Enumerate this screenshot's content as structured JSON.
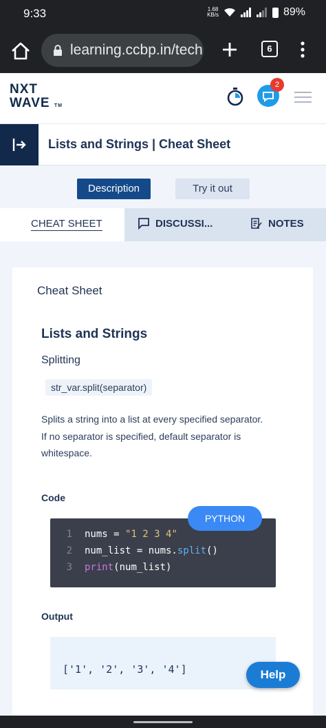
{
  "status": {
    "time": "9:33",
    "speed_value": "1.68",
    "speed_unit": "KB/s",
    "battery": "89%"
  },
  "browser": {
    "url": "learning.ccbp.in/tech",
    "tab_count": "6"
  },
  "app": {
    "logo_line1": "NXT",
    "logo_line2": "WAVE",
    "logo_tm": "TM",
    "notification_count": "2"
  },
  "page": {
    "title": "Lists and Strings | Cheat Sheet"
  },
  "tabs": {
    "description": "Description",
    "try_it_out": "Try it out"
  },
  "subtabs": {
    "cheat_sheet": "CHEAT SHEET",
    "discussions": "DISCUSSI...",
    "notes": "NOTES"
  },
  "content": {
    "heading": "Cheat Sheet",
    "section_title": "Lists and Strings",
    "subsection": "Splitting",
    "inline_code": "str_var.split(separator)",
    "para1": "Splits a string into a list at every specified separator.",
    "para2": "If no separator is specified, default separator is whitespace.",
    "code_label": "Code",
    "language": "PYTHON",
    "code_lines": [
      "nums = \"1 2 3 4\"",
      "num_list = nums.split()",
      "print(num_list)"
    ],
    "output_label": "Output",
    "output": "['1', '2', '3', '4']"
  },
  "help": {
    "label": "Help"
  }
}
